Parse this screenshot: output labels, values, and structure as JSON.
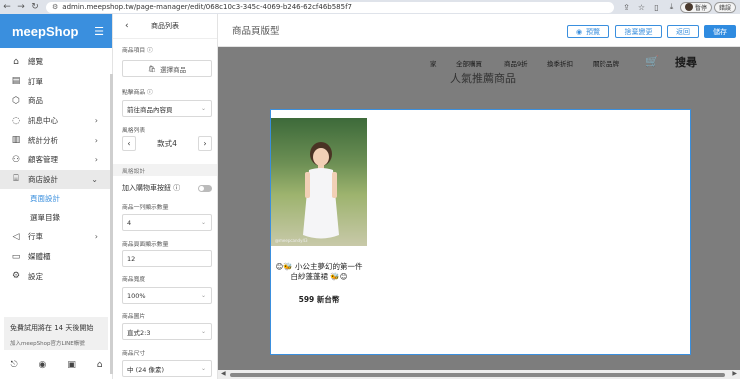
{
  "browser": {
    "url": "admin.meepshop.tw/page-manager/edit/068c10c3-345c-4069-b246-62cf46b585f7",
    "profile_label": "暫停",
    "update_label": "錯誤"
  },
  "sidebar": {
    "logo": "meepShop",
    "items": [
      {
        "label": "總覽",
        "icon": "home-icon"
      },
      {
        "label": "訂單",
        "icon": "order-icon"
      },
      {
        "label": "商品",
        "icon": "box-icon"
      },
      {
        "label": "訊息中心",
        "icon": "chat-icon"
      },
      {
        "label": "統計分析",
        "icon": "analytics-icon"
      },
      {
        "label": "顧客管理",
        "icon": "users-icon"
      },
      {
        "label": "商店設計",
        "icon": "store-icon"
      }
    ],
    "sub_items": [
      {
        "label": "頁面設計"
      },
      {
        "label": "選單目錄"
      }
    ],
    "items_after": [
      {
        "label": "行車",
        "icon": "megaphone-icon"
      },
      {
        "label": "媒體櫃",
        "icon": "folder-icon"
      },
      {
        "label": "設定",
        "icon": "gear-icon"
      }
    ],
    "trial_text": "免費試用將在 14 天後開始",
    "trial_sub": "加入meepShop官方LINE帳號"
  },
  "panel": {
    "title": "商品列表",
    "product_items_label": "商品項目",
    "select_product_button": "選擇商品",
    "click_product_label": "點擊商品",
    "click_product_value": "前往商品內容頁",
    "style_list_label": "風格列表",
    "style_value": "款式4",
    "style_settings_section": "風格設計",
    "add_to_cart_label": "加入購物車按鈕",
    "per_row_label": "商品一列顯示數量",
    "per_row_value": "4",
    "per_page_label": "商品頁面顯示數量",
    "per_page_value": "12",
    "width_label": "商品寬度",
    "width_value": "100%",
    "image_label": "商品圖片",
    "image_value": "直式2:3",
    "size_label": "商品尺寸",
    "size_value": "中 (24 像素)"
  },
  "editor": {
    "title": "商品頁版型",
    "preview_button": "預覽",
    "discard_button": "捨棄變更",
    "back_button": "返回",
    "save_button": "儲存"
  },
  "site": {
    "nav": [
      "家",
      "全部購買",
      "商品9折",
      "換季折扣",
      "關於品牌"
    ],
    "search_text": "搜尋",
    "section_title": "人氣推薦商品",
    "product_name_line1": "😊🐝 小公主夢幻的第一件",
    "product_name_line2": "白紗蓬蓬裙 🐝😊",
    "product_price": "599 新台幣",
    "image_watermark": "@meepcandy43"
  }
}
